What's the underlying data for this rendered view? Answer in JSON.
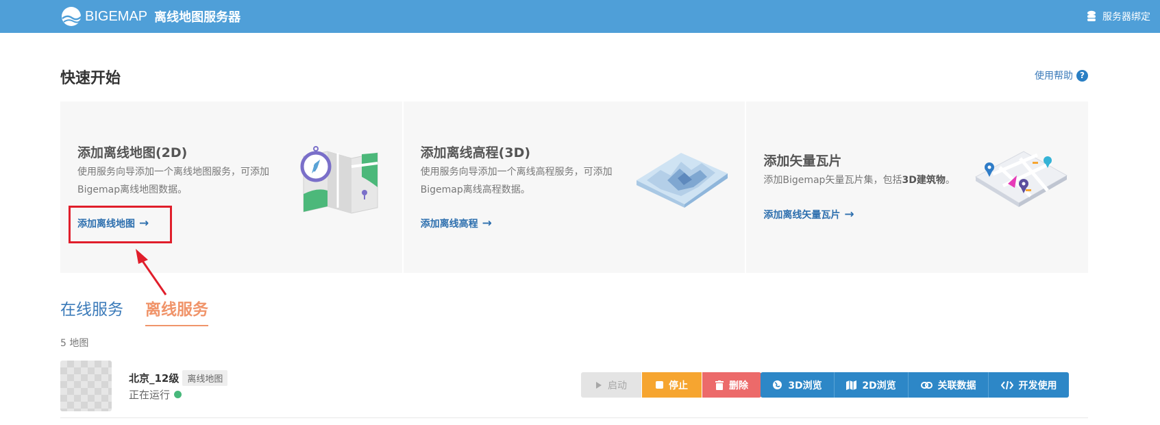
{
  "header": {
    "brand_name": "BIGEMAP",
    "brand_sub": "离线地图服务器",
    "server_bind_label": "服务器绑定",
    "bg_color": "#4f9fd8"
  },
  "quick_start": {
    "title": "快速开始",
    "help_label": "使用帮助",
    "help_icon": "?",
    "cards": [
      {
        "title": "添加离线地图(2D)",
        "desc": "使用服务向导添加一个离线地图服务，可添加Bigemap离线地图数据。",
        "link": "添加离线地图",
        "illustration": "folded-map-compass"
      },
      {
        "title": "添加离线高程(3D)",
        "desc": "使用服务向导添加一个离线高程服务，可添加Bigemap离线高程数据。",
        "link": "添加离线高程",
        "illustration": "terrain-3d"
      },
      {
        "title": "添加矢量瓦片",
        "desc_prefix": "添加Bigemap矢量瓦片集，包括",
        "desc_bold": "3D建筑物",
        "desc_suffix": "。",
        "link": "添加离线矢量瓦片",
        "illustration": "vector-map-pins"
      }
    ]
  },
  "tabs": [
    {
      "label": "在线服务",
      "active": false
    },
    {
      "label": "离线服务",
      "active": true
    }
  ],
  "count_text": "5 地图",
  "services": [
    {
      "name": "北京_12级",
      "type_tag": "离线地图",
      "status": "正在运行",
      "status_color": "#47b87b",
      "actions": {
        "start": "启动",
        "stop": "停止",
        "delete": "删除",
        "view3d": "3D浏览",
        "view2d": "2D浏览",
        "link_data": "关联数据",
        "dev_use": "开发使用"
      }
    }
  ],
  "colors": {
    "accent_blue": "#2d87c7",
    "link_blue": "#2d6fae",
    "stop_orange": "#f6a530",
    "delete_red": "#ec6a6a",
    "tab_active": "#f0946a",
    "annotation_red": "#e01e2b"
  }
}
